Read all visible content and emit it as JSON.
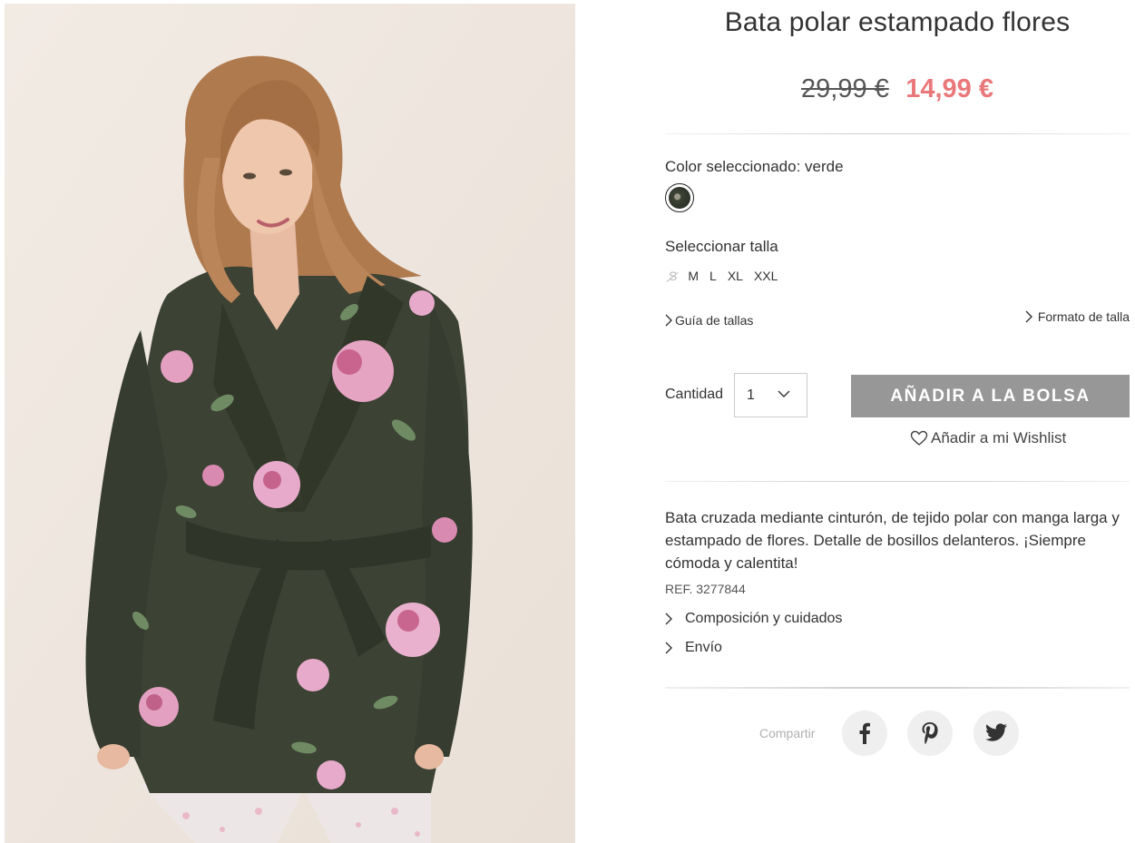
{
  "product": {
    "title": "Bata polar estampado flores",
    "old_price": "29,99 €",
    "price": "14,99 €",
    "color_label": "Color seleccionado: verde",
    "selected_color": "verde",
    "size_label": "Seleccionar talla",
    "sizes": [
      {
        "label": "S",
        "available": false
      },
      {
        "label": "M",
        "available": true
      },
      {
        "label": "L",
        "available": true
      },
      {
        "label": "XL",
        "available": true
      },
      {
        "label": "XXL",
        "available": true
      }
    ],
    "size_guide": "Guía de tallas",
    "size_format": "Formato de talla",
    "quantity_label": "Cantidad",
    "quantity_value": "1",
    "add_to_bag": "AÑADIR A LA BOLSA",
    "wishlist": "Añadir a mi Wishlist",
    "description": "Bata cruzada mediante cinturón, de tejido polar con manga larga y estampado de flores. Detalle de bosillos delanteros. ¡Siempre cómoda y calentita!",
    "ref": "REF. 3277844",
    "accordion": [
      "Composición y cuidados",
      "Envío"
    ],
    "share_label": "Compartir",
    "social": [
      "facebook-icon",
      "pinterest-icon",
      "twitter-icon"
    ]
  },
  "colors": {
    "sale_price": "#e9787a",
    "button_bg": "#979797",
    "swatch": "#3a4034"
  }
}
